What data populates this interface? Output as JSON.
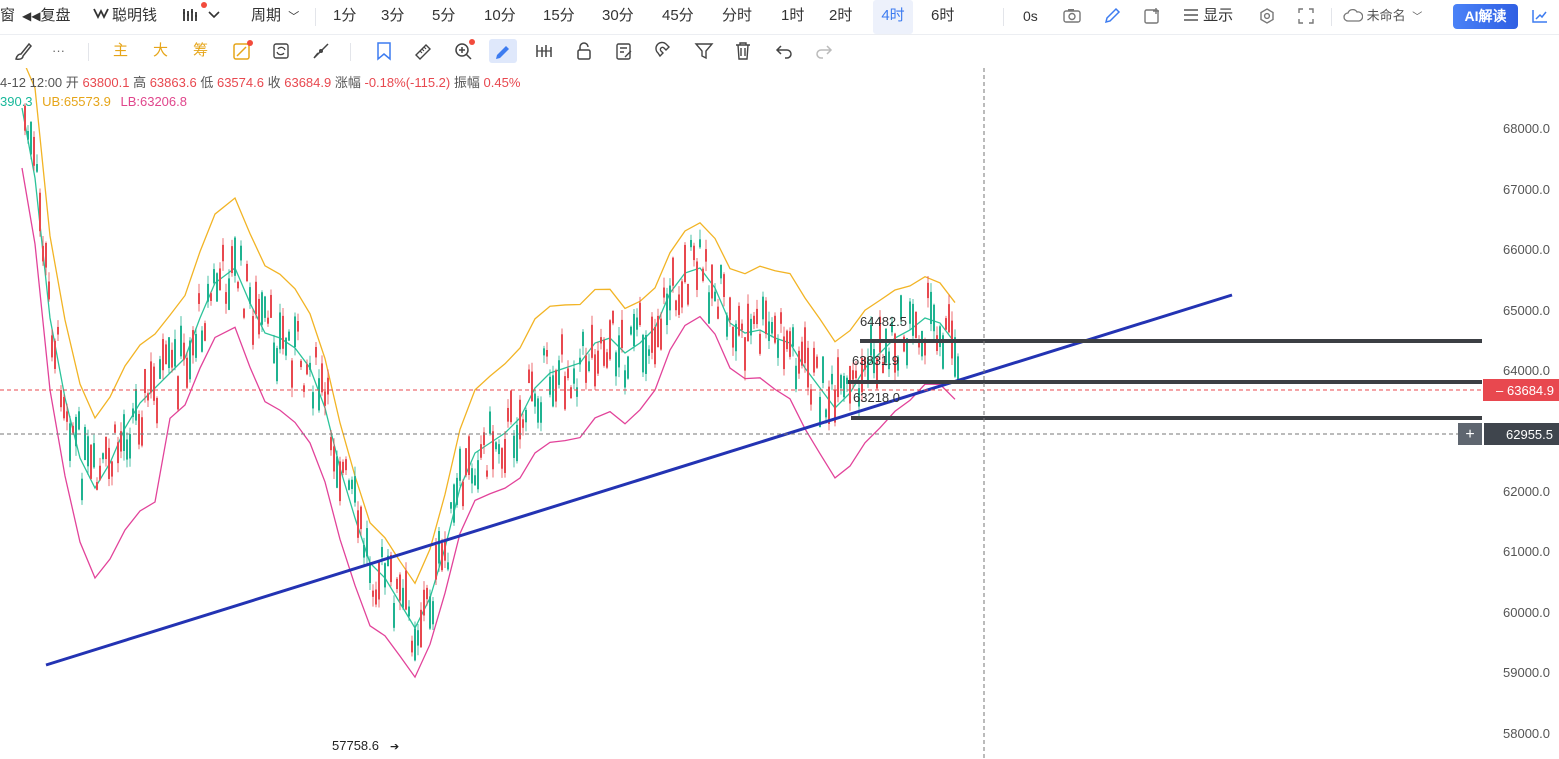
{
  "topbar": {
    "partial_label": "窗",
    "replay": "复盘",
    "smart_money": "聪明钱",
    "period_label": "周期",
    "intervals": [
      "1分",
      "3分",
      "5分",
      "10分",
      "15分",
      "30分",
      "45分",
      "分时",
      "1时",
      "2时",
      "4时",
      "6时"
    ],
    "active_interval": "4时",
    "countdown": "0s",
    "display_label": "显示",
    "layout_name": "未命名",
    "ai_button": "AI解读"
  },
  "toolbar2": {
    "more": "···",
    "main": "主",
    "large": "大",
    "chips": "筹"
  },
  "ohlc": {
    "date": "4-12 12:00",
    "open_label": "开",
    "open": "63800.1",
    "high_label": "高",
    "high": "63863.6",
    "low_label": "低",
    "low": "63574.6",
    "close_label": "收",
    "close": "63684.9",
    "change_label": "涨幅",
    "change": "-0.18%(-115.2)",
    "amp_label": "振幅",
    "amp": "0.45%"
  },
  "bands": {
    "mid": "390.3",
    "ub": "UB:65573.9",
    "lb": "LB:63206.8"
  },
  "axis": {
    "ticks": [
      "68000.0",
      "67000.0",
      "66000.0",
      "65000.0",
      "64000.0",
      "62000.0",
      "61000.0",
      "60000.0",
      "59000.0",
      "58000.0"
    ],
    "last_price": "63684.9",
    "crosshair_price": "62955.5"
  },
  "annotations": {
    "level_high": "64482.5",
    "level_mid": "63831.9",
    "level_low": "63218.0",
    "min_low": "57758.6"
  },
  "colors": {
    "up": "#1fb391",
    "down": "#e8484f",
    "upper_band": "#f2b425",
    "mid_band": "#2cc39a",
    "lower_band": "#e2439a",
    "trendline": "#2333b3",
    "accent": "#3d7cf0"
  }
}
